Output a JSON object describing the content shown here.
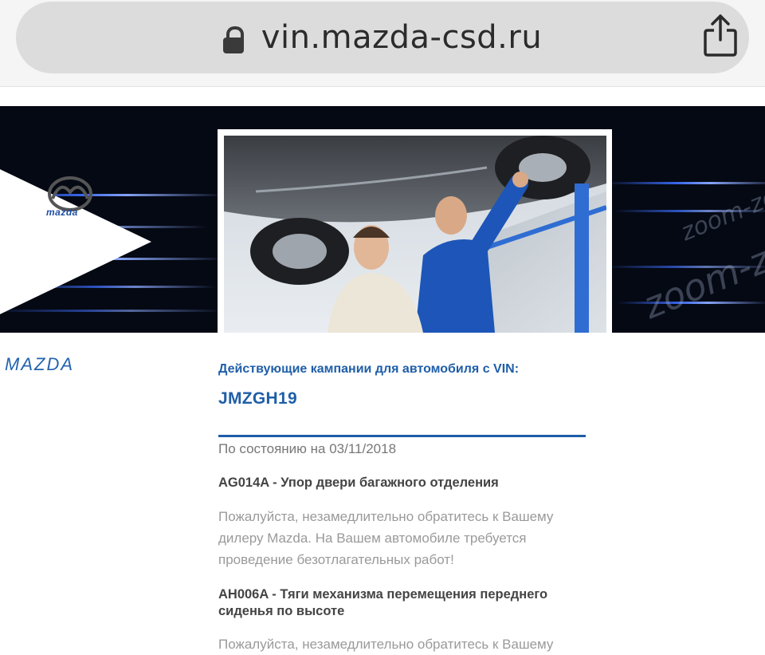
{
  "browser": {
    "url": "vin.mazda-csd.ru",
    "lock_icon": "lock-icon",
    "share_icon": "share-icon"
  },
  "banner": {
    "logo_text": "mazda",
    "watermark": "zoom-zoom"
  },
  "sidebar": {
    "brand": "MAZDA"
  },
  "main": {
    "heading": "Действующие кампании для автомобиля с VIN:",
    "vin": "JMZGH19",
    "status_date": "По состоянию на 03/11/2018",
    "campaigns": [
      {
        "title": "AG014A - Упор двери багажного отделения",
        "text": "Пожалуйста, незамедлительно обратитесь к Вашему дилеру Mazda. На Вашем автомобиле требуется проведение безотлагательных работ!"
      },
      {
        "title": "AH006A - Тяги механизма перемещения переднего сиденья по высоте",
        "text": "Пожалуйста, незамедлительно обратитесь к Вашему"
      }
    ]
  },
  "colors": {
    "accent": "#1f5ea8",
    "banner_bg": "#050914",
    "url_bar": "#dcdcdc"
  }
}
